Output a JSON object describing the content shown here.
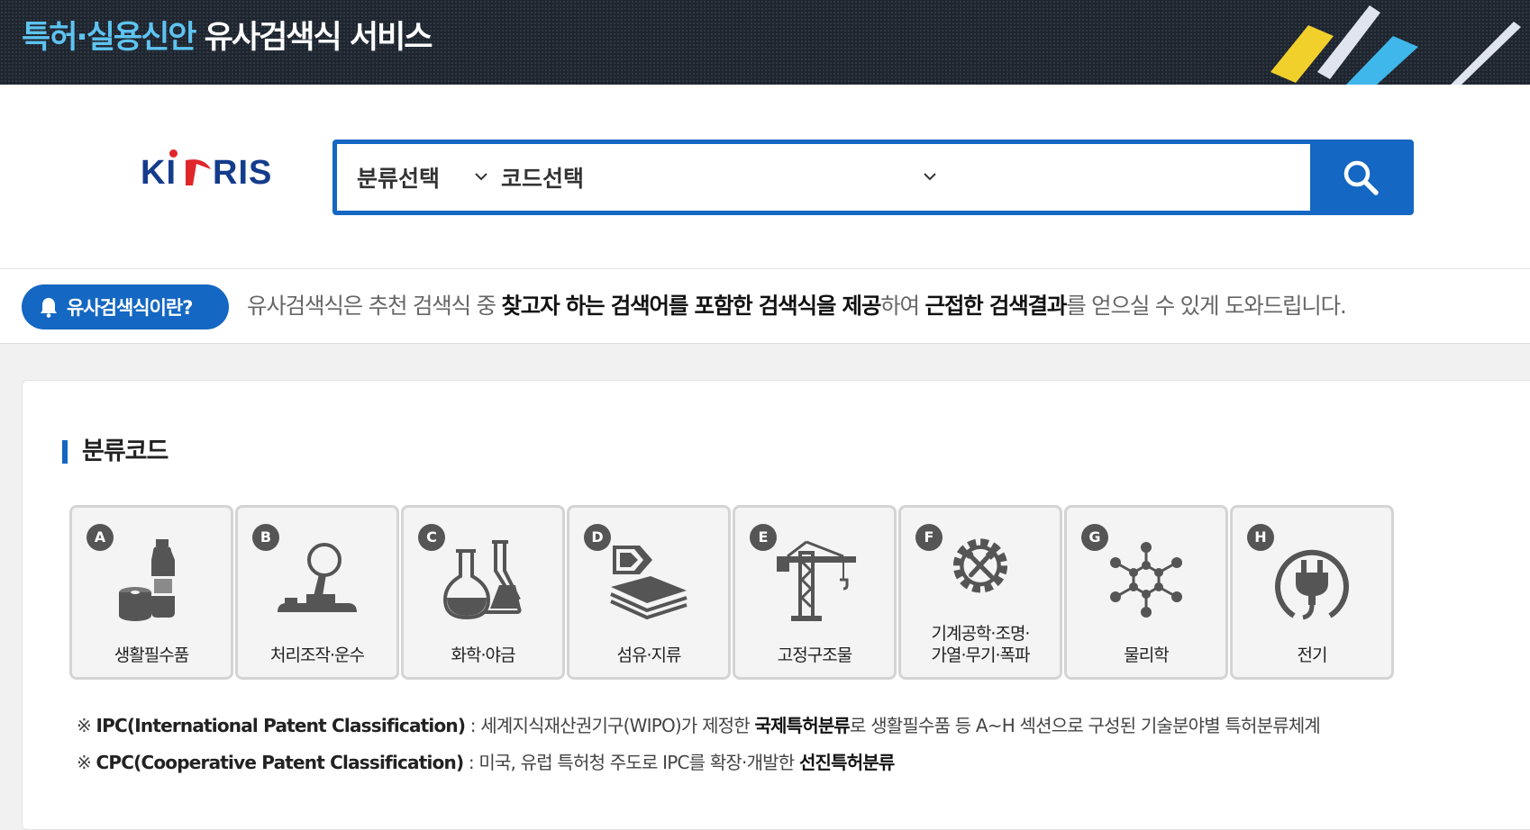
{
  "header": {
    "title_accent": "특허·실용신안",
    "title_rest": " 유사검색식 서비스",
    "logo_text": "KIPRIS"
  },
  "search": {
    "class_select_label": "분류선택",
    "code_select_label": "코드선택",
    "input_value": "",
    "button_icon": "search-icon",
    "accent_color": "#1467c2"
  },
  "info": {
    "button_label": "유사검색식이란?",
    "button_icon": "bell-icon",
    "text_1": "유사검색식은 추천 검색식 중 ",
    "text_2_bold": "찾고자 하는 검색어를 포함한 검색식을 제공",
    "text_3": "하여 ",
    "text_4_bold": "근접한 검색결과",
    "text_5": "를 얻으실 수 있게 도와드립니다."
  },
  "section": {
    "title": "분류코드"
  },
  "categories": [
    {
      "code": "A",
      "lines": [
        "생활필수품"
      ],
      "icon": "bottle-icon"
    },
    {
      "code": "B",
      "lines": [
        "처리조작·운수"
      ],
      "icon": "joystick-icon"
    },
    {
      "code": "C",
      "lines": [
        "화학·야금"
      ],
      "icon": "flask-icon"
    },
    {
      "code": "D",
      "lines": [
        "섬유·지류"
      ],
      "icon": "paper-stack-icon"
    },
    {
      "code": "E",
      "lines": [
        "고정구조물"
      ],
      "icon": "crane-icon"
    },
    {
      "code": "F",
      "lines": [
        "기계공학·조명·",
        "가열·무기·폭파"
      ],
      "icon": "gear-tools-icon"
    },
    {
      "code": "G",
      "lines": [
        "물리학"
      ],
      "icon": "molecule-icon"
    },
    {
      "code": "H",
      "lines": [
        "전기"
      ],
      "icon": "plug-icon"
    }
  ],
  "notes": [
    {
      "mark": "※ ",
      "key": "IPC(International Patent Classification)",
      "text_1": " : 세계지식재산권기구(WIPO)가 제정한 ",
      "bold": "국제특허분류",
      "text_2": "로 생활필수품 등 A~H 섹션으로 구성된 기술분야별 특허분류체계"
    },
    {
      "mark": "※ ",
      "key": "CPC(Cooperative Patent Classification)",
      "text_1": " : 미국, 유럽 특허청 주도로 IPC를 확장·개발한 ",
      "bold": "선진특허분류",
      "text_2": ""
    }
  ]
}
